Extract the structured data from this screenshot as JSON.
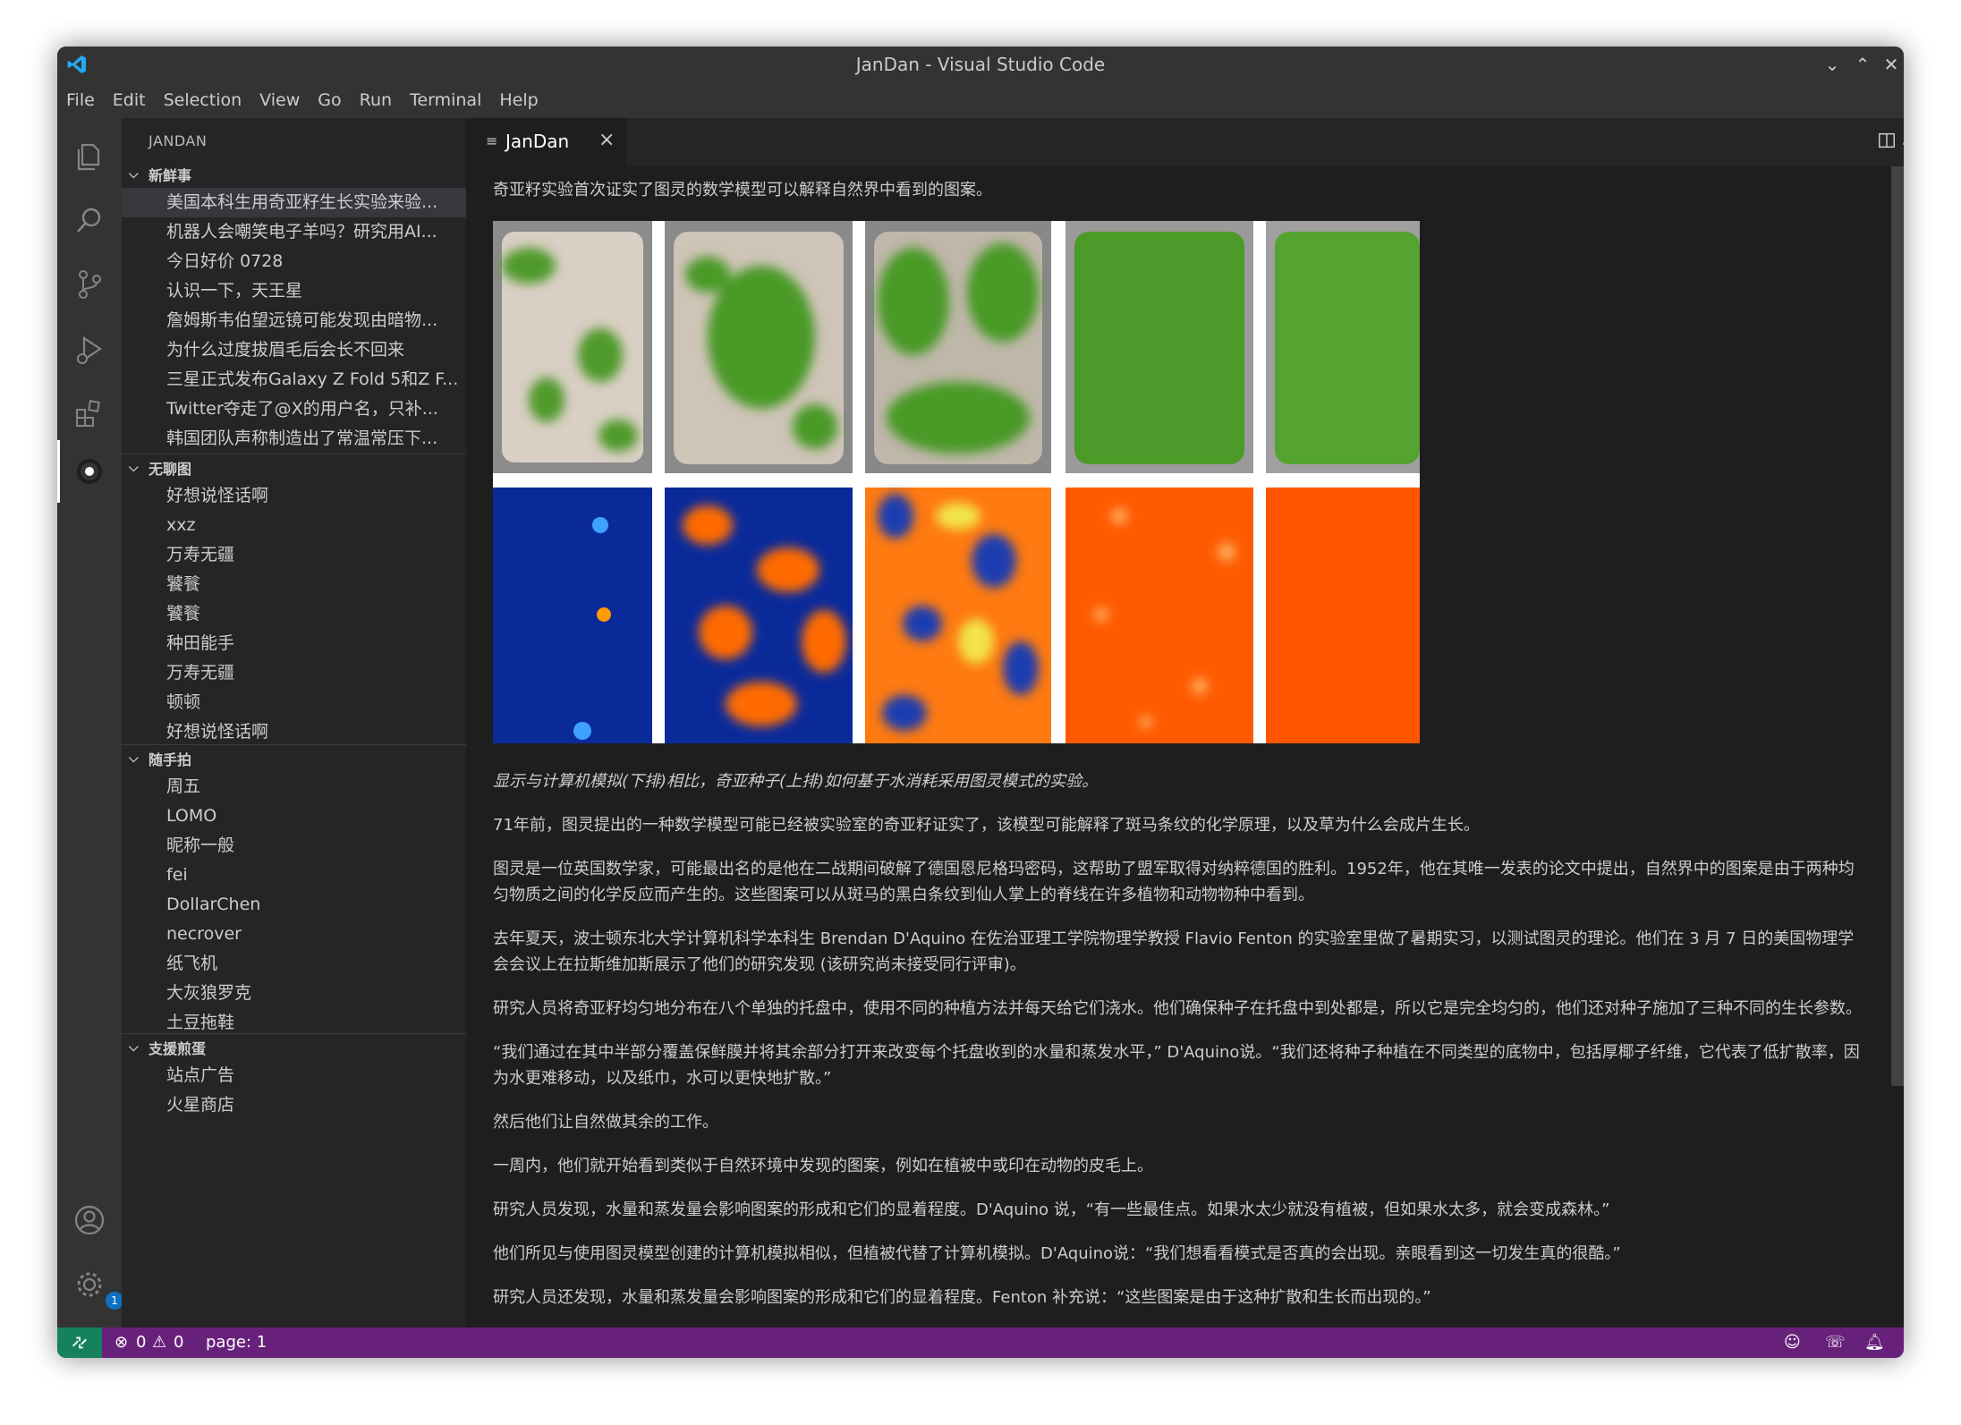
{
  "window": {
    "title": "JanDan - Visual Studio Code"
  },
  "menu": [
    "File",
    "Edit",
    "Selection",
    "View",
    "Go",
    "Run",
    "Terminal",
    "Help"
  ],
  "sidebar": {
    "title": "JANDAN",
    "sections": [
      {
        "label": "新鲜事",
        "items": [
          "美国本科生用奇亚籽生长实验来验...",
          "机器人会嘲笑电子羊吗？研究用AI...",
          "今日好价 0728",
          "认识一下，天王星",
          "詹姆斯韦伯望远镜可能发现由暗物...",
          "为什么过度拔眉毛后会长不回来",
          "三星正式发布Galaxy Z Fold 5和Z F...",
          "Twitter夺走了@X的用户名，只补...",
          "韩国团队声称制造出了常温常压下..."
        ]
      },
      {
        "label": "无聊图",
        "items": [
          "好想说怪话啊",
          "xxz",
          "万寿无疆",
          "饕餮",
          "饕餮",
          "种田能手",
          "万寿无疆",
          "顿顿",
          "好想说怪话啊"
        ]
      },
      {
        "label": "随手拍",
        "items": [
          "周五",
          "LOMO",
          "昵称一般",
          "fei",
          "DollarChen",
          "necrover",
          "纸飞机",
          "大灰狼罗克",
          "土豆拖鞋"
        ]
      },
      {
        "label": "支援煎蛋",
        "items": [
          "站点广告",
          "火星商店"
        ]
      }
    ]
  },
  "tab": {
    "label": "JanDan",
    "icon": "preview-icon"
  },
  "article": {
    "intro": "奇亚籽实验首次证实了图灵的数学模型可以解释自然界中看到的图案。",
    "caption": "显示与计算机模拟(下排)相比，奇亚种子(上排)如何基于水消耗采用图灵模式的实验。",
    "paragraphs": [
      "71年前，图灵提出的一种数学模型可能已经被实验室的奇亚籽证实了，该模型可能解释了斑马条纹的化学原理，以及草为什么会成片生长。",
      "图灵是一位英国数学家，可能最出名的是他在二战期间破解了德国恩尼格玛密码，这帮助了盟军取得对纳粹德国的胜利。1952年，他在其唯一发表的论文中提出，自然界中的图案是由于两种均匀物质之间的化学反应而产生的。这些图案可以从斑马的黑白条纹到仙人掌上的脊线在许多植物和动物物种中看到。",
      "去年夏天，波士顿东北大学计算机科学本科生 Brendan D'Aquino 在佐治亚理工学院物理学教授 Flavio Fenton 的实验室里做了暑期实习，以测试图灵的理论。他们在 3 月 7 日的美国物理学会会议上在拉斯维加斯展示了他们的研究发现 (该研究尚未接受同行评审)。",
      "研究人员将奇亚籽均匀地分布在八个单独的托盘中，使用不同的种植方法并每天给它们浇水。他们确保种子在托盘中到处都是，所以它是完全均匀的，他们还对种子施加了三种不同的生长参数。",
      "“我们通过在其中半部分覆盖保鲜膜并将其余部分打开来改变每个托盘收到的水量和蒸发水平，” D'Aquino说。“我们还将种子种植在不同类型的底物中，包括厚椰子纤维，它代表了低扩散率，因为水更难移动，以及纸巾，水可以更快地扩散。”",
      "然后他们让自然做其余的工作。",
      "一周内，他们就开始看到类似于自然环境中发现的图案，例如在植被中或印在动物的皮毛上。",
      "研究人员发现，水量和蒸发量会影响图案的形成和它们的显着程度。D'Aquino 说，“有一些最佳点。如果水太少就没有植被，但如果水太多，就会变成森林。”",
      "他们所见与使用图灵模型创建的计算机模拟相似，但植被代替了计算机模拟。D'Aquino说：“我们想看看模式是否真的会出现。亲眼看到这一切发生真的很酷。”",
      "研究人员还发现，水量和蒸发量会影响图案的形成和它们的显着程度。Fenton 补充说：“这些图案是由于这种扩散和生长而出现的。”"
    ]
  },
  "status": {
    "errors": "0",
    "warnings": "0",
    "page": "page: 1"
  },
  "colors": {
    "statusbar": "#68217a",
    "remote": "#16825d",
    "accent": "#0e70c0"
  }
}
